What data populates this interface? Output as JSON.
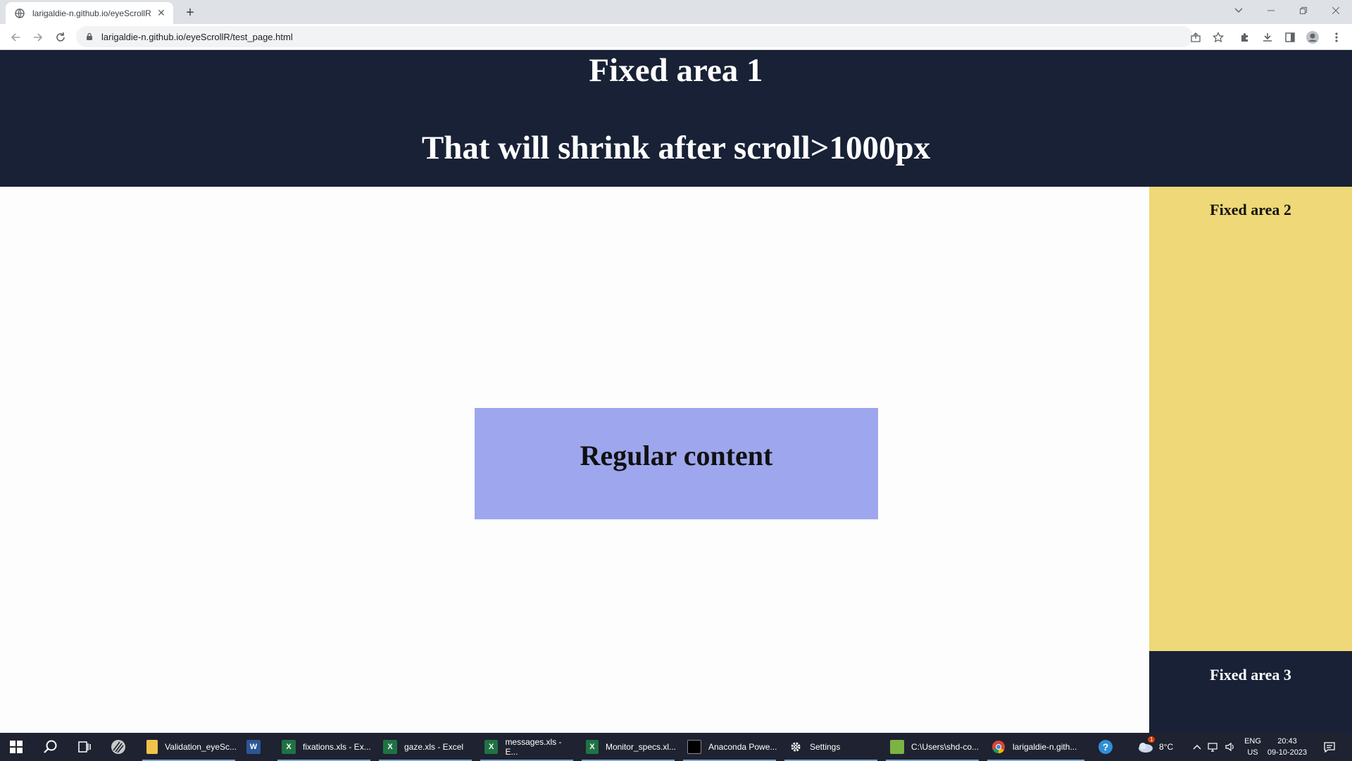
{
  "browser": {
    "tab_title": "larigaldie-n.github.io/eyeScrollR",
    "url": "larigaldie-n.github.io/eyeScrollR/test_page.html",
    "new_tab_label": "+"
  },
  "page": {
    "fixed_area_1_title": "Fixed area 1",
    "fixed_area_1_subtitle": "That will shrink after scroll>1000px",
    "fixed_area_2_label": "Fixed area 2",
    "fixed_area_3_label": "Fixed area 3",
    "regular_content_label": "Regular content",
    "colors": {
      "header": "#182135",
      "fixed_area_2": "#efd877",
      "regular_content": "#9ea7ed",
      "background": "#fcfdfc"
    }
  },
  "taskbar": {
    "apps": [
      {
        "label": "Validation_eyeSc...",
        "icon": "folder-icon"
      },
      {
        "label": "",
        "icon": "word-icon"
      },
      {
        "label": "fixations.xls - Ex...",
        "icon": "excel-icon"
      },
      {
        "label": "gaze.xls - Excel",
        "icon": "excel-icon"
      },
      {
        "label": "messages.xls - E...",
        "icon": "excel-icon"
      },
      {
        "label": "Monitor_specs.xl...",
        "icon": "excel-icon"
      },
      {
        "label": "Anaconda Powe...",
        "icon": "terminal-icon"
      },
      {
        "label": "Settings",
        "icon": "gear-icon"
      },
      {
        "label": "C:\\Users\\shd-co...",
        "icon": "notepad-icon"
      },
      {
        "label": "larigaldie-n.gith...",
        "icon": "chrome-icon"
      }
    ],
    "weather_temp": "8°C",
    "lang_line1": "ENG",
    "lang_line2": "US",
    "time": "20:43",
    "date": "09-10-2023",
    "notification_count": "1"
  }
}
